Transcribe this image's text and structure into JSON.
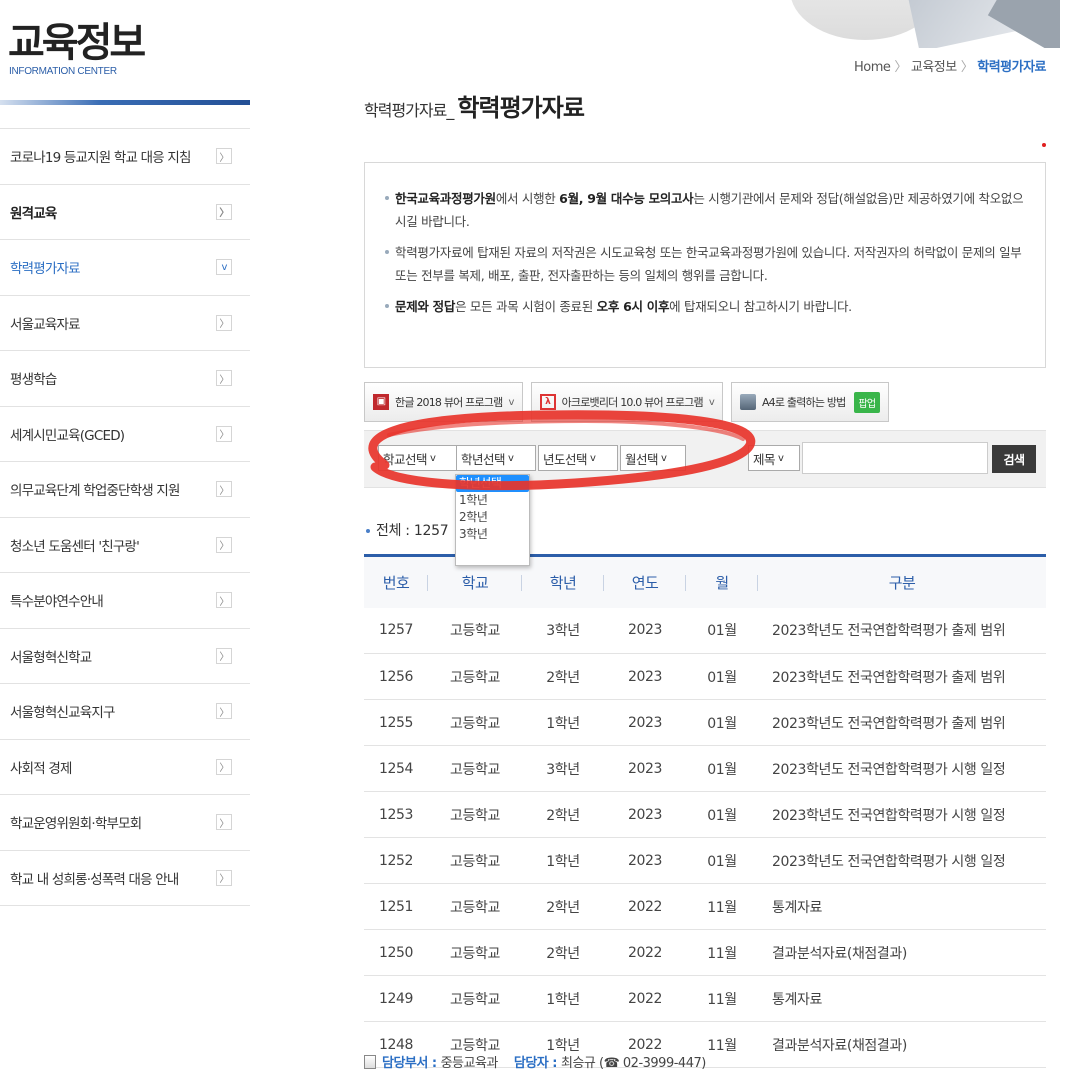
{
  "sidebar": {
    "title": "교육정보",
    "subtitle": "INFORMATION CENTER",
    "items": [
      {
        "label": "코로나19 등교지원 학교 대응 지침",
        "bold": false,
        "active": false,
        "arrow": "〉"
      },
      {
        "label": "원격교육",
        "bold": true,
        "active": false,
        "arrow": "〉"
      },
      {
        "label": "학력평가자료",
        "bold": false,
        "active": true,
        "arrow": "v"
      },
      {
        "label": "서울교육자료",
        "bold": false,
        "active": false,
        "arrow": "〉"
      },
      {
        "label": "평생학습",
        "bold": false,
        "active": false,
        "arrow": "〉"
      },
      {
        "label": "세계시민교육(GCED)",
        "bold": false,
        "active": false,
        "arrow": "〉"
      },
      {
        "label": "의무교육단계 학업중단학생 지원",
        "bold": false,
        "active": false,
        "arrow": "〉"
      },
      {
        "label": "청소년 도움센터 '친구랑'",
        "bold": false,
        "active": false,
        "arrow": "〉"
      },
      {
        "label": "특수분야연수안내",
        "bold": false,
        "active": false,
        "arrow": "〉"
      },
      {
        "label": "서울형혁신학교",
        "bold": false,
        "active": false,
        "arrow": "〉"
      },
      {
        "label": "서울형혁신교육지구",
        "bold": false,
        "active": false,
        "arrow": "〉"
      },
      {
        "label": "사회적 경제",
        "bold": false,
        "active": false,
        "arrow": "〉"
      },
      {
        "label": "학교운영위원회·학부모회",
        "bold": false,
        "active": false,
        "arrow": "〉"
      },
      {
        "label": "학교 내 성희롱·성폭력 대응 안내",
        "bold": false,
        "active": false,
        "arrow": "〉"
      }
    ]
  },
  "breadcrumb": {
    "home": "Home",
    "level1": "교육정보",
    "current": "학력평가자료",
    "separator": "〉"
  },
  "page": {
    "title_small": "학력평가자료_",
    "title_big": "학력평가자료"
  },
  "notice": {
    "line1": {
      "b1": "한국교육과정평가원",
      "t1": "에서 시행한 ",
      "b2": "6월, 9월 대수능 모의고사",
      "t2": "는 시행기관에서 문제와 정답(해설없음)만 제공하였기에 착오없으시길 바랍니다."
    },
    "line2": "학력평가자료에 탑재된 자료의 저작권은 시도교육청 또는 한국교육과정평가원에 있습니다. 저작권자의 허락없이 문제의 일부 또는 전부를 복제, 배포, 출판, 전자출판하는 등의 일체의 행위를 금합니다.",
    "line3": {
      "b1": "문제와 정답",
      "t1": "은 모든 과목 시험이 종료된 ",
      "b2": "오후 6시 이후",
      "t2": "에 탑재되오니 참고하시기 바랍니다."
    }
  },
  "toolbar": {
    "hwp_label": "한글 2018 뷰어 프로그램",
    "pdf_label": "아크로뱃리더 10.0 뷰어 프로그램",
    "print_label": "A4로 출력하는 방법",
    "popup_label": "팝업"
  },
  "search": {
    "school_select": "학교선택",
    "grade_select": "학년선택",
    "year_select": "년도선택",
    "month_select": "월선택",
    "field_select": "제목",
    "input_value": "",
    "button_label": "검색",
    "caret": "v"
  },
  "grade_dropdown": {
    "options": [
      "학년선택",
      "1학년",
      "2학년",
      "3학년"
    ],
    "highlighted_index": 0
  },
  "list": {
    "total_label": "전체 : ",
    "total_value": "1257",
    "headers": [
      "번호",
      "학교",
      "학년",
      "연도",
      "월",
      "구분"
    ],
    "rows": [
      [
        "1257",
        "고등학교",
        "3학년",
        "2023",
        "01월",
        "2023학년도 전국연합학력평가 출제 범위"
      ],
      [
        "1256",
        "고등학교",
        "2학년",
        "2023",
        "01월",
        "2023학년도 전국연합학력평가 출제 범위"
      ],
      [
        "1255",
        "고등학교",
        "1학년",
        "2023",
        "01월",
        "2023학년도 전국연합학력평가 출제 범위"
      ],
      [
        "1254",
        "고등학교",
        "3학년",
        "2023",
        "01월",
        "2023학년도 전국연합학력평가 시행 일정"
      ],
      [
        "1253",
        "고등학교",
        "2학년",
        "2023",
        "01월",
        "2023학년도 전국연합학력평가 시행 일정"
      ],
      [
        "1252",
        "고등학교",
        "1학년",
        "2023",
        "01월",
        "2023학년도 전국연합학력평가 시행 일정"
      ],
      [
        "1251",
        "고등학교",
        "2학년",
        "2022",
        "11월",
        "통계자료"
      ],
      [
        "1250",
        "고등학교",
        "2학년",
        "2022",
        "11월",
        "결과분석자료(채점결과)"
      ],
      [
        "1249",
        "고등학교",
        "1학년",
        "2022",
        "11월",
        "통계자료"
      ],
      [
        "1248",
        "고등학교",
        "1학년",
        "2022",
        "11월",
        "결과분석자료(채점결과)"
      ]
    ]
  },
  "footer": {
    "dept_label": "담당부서 :",
    "dept_value": "중등교육과",
    "person_label": "담당자 :",
    "person_value": "최승규 (☎ 02-3999-447)"
  },
  "colors": {
    "accent_blue": "#2c6fc4",
    "table_border": "#2c5ea9",
    "annotation_red": "#e8342b",
    "popup_green": "#39b54a"
  }
}
